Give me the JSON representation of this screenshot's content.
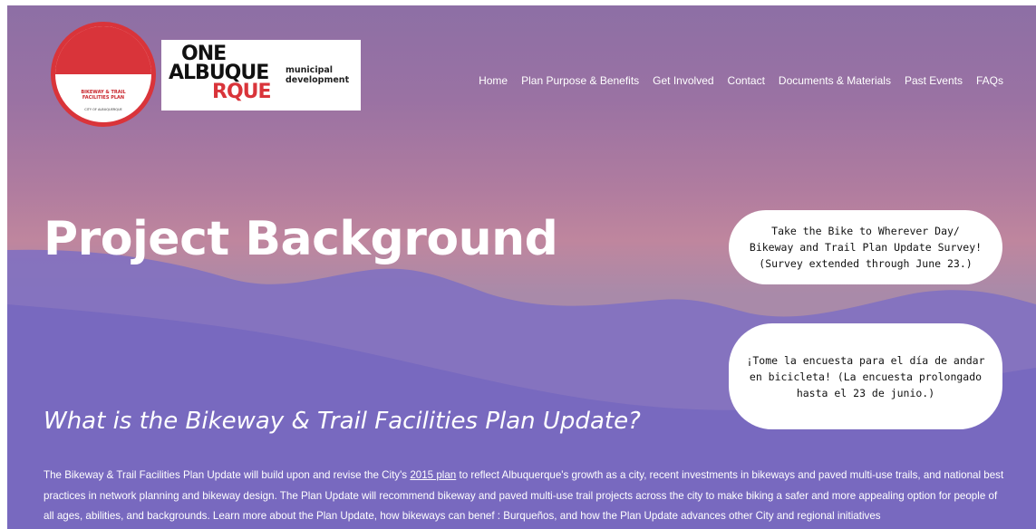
{
  "logo": {
    "badge_line1": "BIKEWAY & TRAIL",
    "badge_line2": "FACILITIES PLAN",
    "badge_line3": "CITY OF ALBUQUERQUE",
    "brand_word1": "ONE",
    "brand_word2": "ALBUQUE",
    "brand_word3": "RQUE",
    "brand_sub1": "municipal",
    "brand_sub2": "development"
  },
  "nav": {
    "items": [
      "Home",
      "Plan Purpose & Benefits",
      "Get Involved",
      "Contact",
      "Documents & Materials",
      "Past Events",
      "FAQs"
    ]
  },
  "hero": {
    "title": "Project Background"
  },
  "survey_en": {
    "line1": "Take the Bike to Wherever Day/",
    "line2": "Bikeway and Trail Plan Update Survey!",
    "line3": "(Survey extended through June 23.)"
  },
  "survey_es": {
    "line1": "¡Tome la encuesta para el día de andar",
    "line2": "en bicicleta! (La encuesta prolongado",
    "line3": "hasta el 23 de junio.)"
  },
  "section": {
    "heading": "What is the Bikeway & Trail Facilities Plan Update?",
    "para_before_link": "The Bikeway & Trail Facilities Plan Update will build upon and revise the City's ",
    "link_text": "2015 plan",
    "para_after_link": " to reflect Albuquerque's growth as a city, recent investments in bikeways and paved multi-use trails, and national best practices in network planning and bikeway design. The Plan Update will recommend bikeway and paved multi-use trail projects across the city to make biking a safer and more appealing option for people of all ages,  abilities, and backgrounds. Learn more about the Plan Update, how bikeways can benef : Burqueños, and how the Plan Update advances other City and regional initiatives"
  },
  "colors": {
    "accent_red": "#d9343a",
    "sky_top": "#8d6fa5",
    "mountain": "#7a6bc4"
  }
}
